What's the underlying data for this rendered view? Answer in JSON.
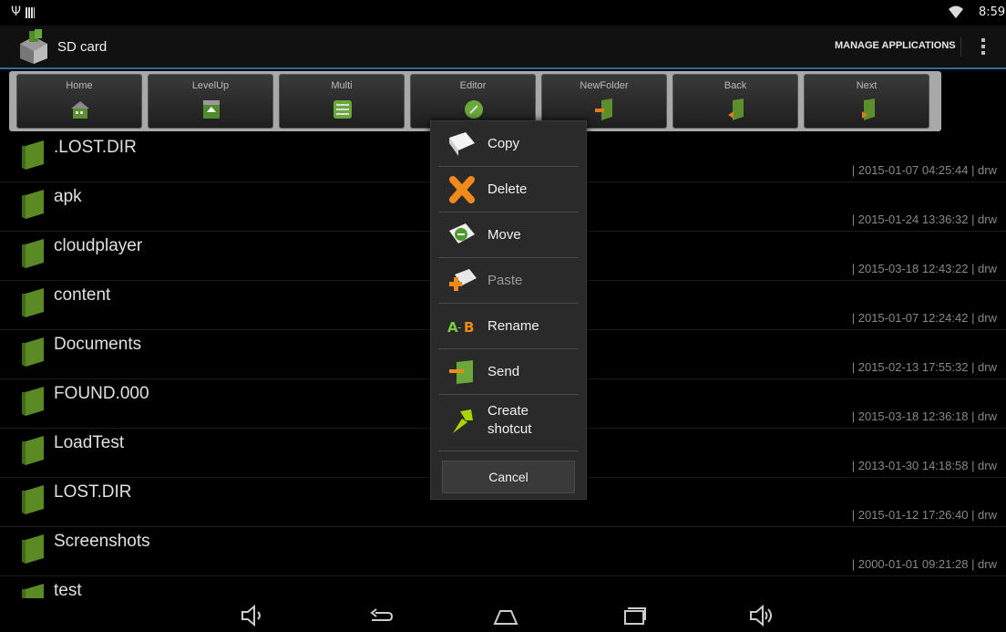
{
  "status_bar": {
    "time": "8:59",
    "icons": [
      "usb-icon",
      "sim-icon",
      "wifi-icon"
    ]
  },
  "action_bar": {
    "title": "SD card",
    "manage_label": "MANAGE APPLICATIONS"
  },
  "toolbar": {
    "buttons": [
      {
        "label": "Home",
        "icon": "home-icon"
      },
      {
        "label": "LevelUp",
        "icon": "level-up-icon"
      },
      {
        "label": "Multi",
        "icon": "multi-select-icon"
      },
      {
        "label": "Editor",
        "icon": "editor-icon"
      },
      {
        "label": "NewFolder",
        "icon": "new-folder-icon"
      },
      {
        "label": "Back",
        "icon": "back-icon"
      },
      {
        "label": "Next",
        "icon": "next-icon"
      }
    ]
  },
  "files": [
    {
      "name": ".LOST.DIR",
      "meta": "| 2015-01-07 04:25:44 | drw"
    },
    {
      "name": "apk",
      "meta": "| 2015-01-24 13:36:32 | drw"
    },
    {
      "name": "cloudplayer",
      "meta": "| 2015-03-18 12:43:22 | drw"
    },
    {
      "name": "content",
      "meta": "| 2015-01-07 12:24:42 | drw"
    },
    {
      "name": "Documents",
      "meta": "| 2015-02-13 17:55:32 | drw"
    },
    {
      "name": "FOUND.000",
      "meta": "| 2015-03-18 12:36:18 | drw"
    },
    {
      "name": "LoadTest",
      "meta": "| 2013-01-30 14:18:58 | drw"
    },
    {
      "name": "LOST.DIR",
      "meta": "| 2015-01-12 17:26:40 | drw"
    },
    {
      "name": "Screenshots",
      "meta": "| 2000-01-01 09:21:28 | drw"
    },
    {
      "name": "test",
      "meta": ""
    }
  ],
  "context_menu": {
    "items": [
      {
        "label": "Copy",
        "icon": "copy-icon",
        "enabled": true
      },
      {
        "label": "Delete",
        "icon": "delete-icon",
        "enabled": true
      },
      {
        "label": "Move",
        "icon": "move-icon",
        "enabled": true
      },
      {
        "label": "Paste",
        "icon": "paste-icon",
        "enabled": false
      },
      {
        "label": "Rename",
        "icon": "rename-icon",
        "enabled": true
      },
      {
        "label": "Send",
        "icon": "send-icon",
        "enabled": true
      },
      {
        "label": "Create\nshotcut",
        "icon": "shortcut-pin-icon",
        "enabled": true
      }
    ],
    "cancel_label": "Cancel"
  },
  "nav_bar": {
    "icons": [
      "volume-down-icon",
      "back-nav-icon",
      "home-nav-icon",
      "recent-apps-icon",
      "volume-up-icon"
    ]
  },
  "colors": {
    "accent_rule": "#2c6f8f",
    "folder_green": "#6b8f2a",
    "menu_bg": "#2a2a2a"
  }
}
